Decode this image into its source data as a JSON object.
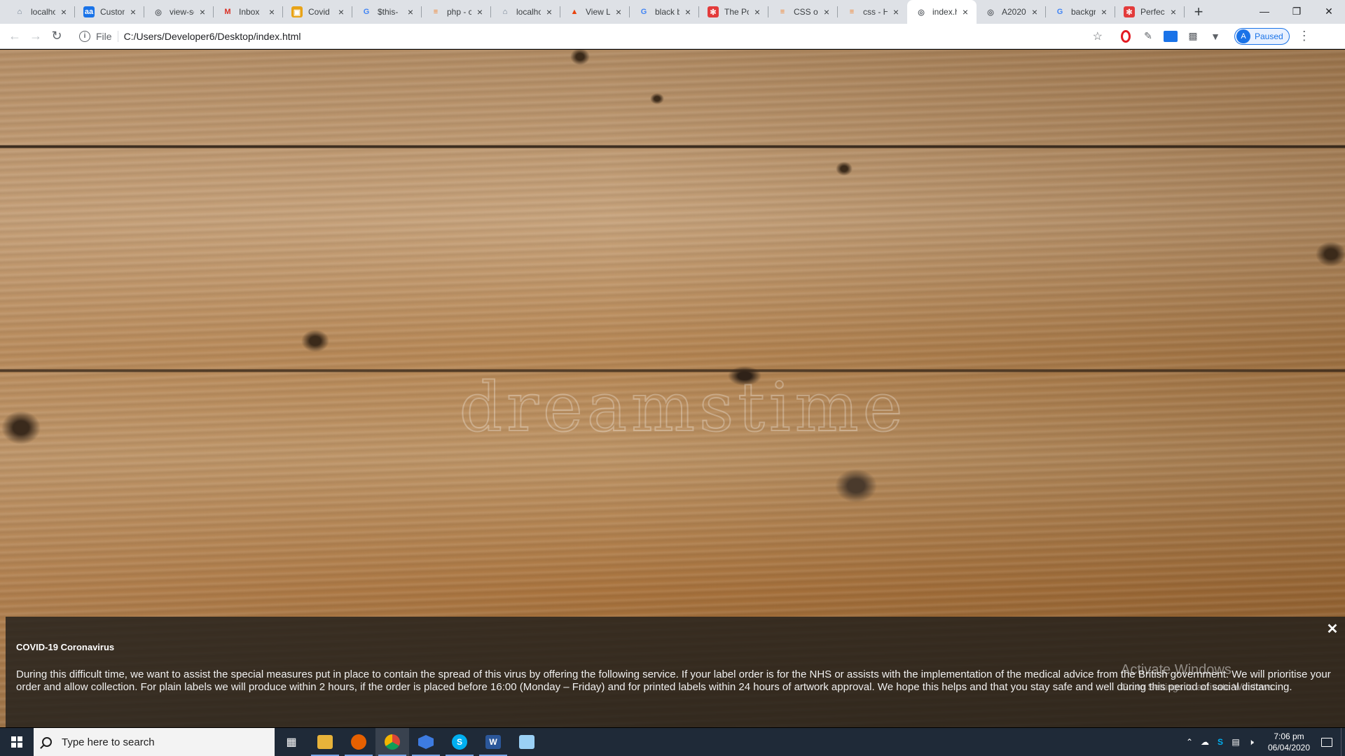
{
  "tabs": [
    {
      "label": "localhost",
      "icon": "localhost-icon",
      "active": false
    },
    {
      "label": "Customer",
      "icon": "aa-icon",
      "active": false
    },
    {
      "label": "view-source",
      "icon": "globe-icon",
      "active": false
    },
    {
      "label": "Inbox",
      "icon": "gmail-icon",
      "active": false
    },
    {
      "label": "Covid",
      "icon": "covid-icon",
      "active": false
    },
    {
      "label": "$this-",
      "icon": "google-icon",
      "active": false
    },
    {
      "label": "php - c",
      "icon": "stackoverflow-icon",
      "active": false
    },
    {
      "label": "localhost",
      "icon": "localhost-icon",
      "active": false
    },
    {
      "label": "View L",
      "icon": "flame-icon",
      "active": false
    },
    {
      "label": "black b",
      "icon": "google-icon",
      "active": false
    },
    {
      "label": "The Po",
      "icon": "pinwheel-icon",
      "active": false
    },
    {
      "label": "CSS op",
      "icon": "stackoverflow-icon",
      "active": false
    },
    {
      "label": "css - H",
      "icon": "stackoverflow-icon",
      "active": false
    },
    {
      "label": "index.h",
      "icon": "globe-icon",
      "active": true
    },
    {
      "label": "A2020",
      "icon": "globe-icon",
      "active": false
    },
    {
      "label": "backgr",
      "icon": "google-icon",
      "active": false
    },
    {
      "label": "Perfec",
      "icon": "pinwheel-icon",
      "active": false
    }
  ],
  "toolbar": {
    "scheme": "File",
    "url": "C:/Users/Developer6/Desktop/index.html",
    "profile_initial": "A",
    "profile_label": "Paused"
  },
  "page": {
    "watermark": "dreamstime"
  },
  "notice": {
    "title": "COVID-19 Coronavirus",
    "body": "During this difficult time, we want to assist the special measures put in place to contain the spread of this virus by offering the following service. If your label order is for the NHS or assists with the implementation of the medical advice from the British government. We will prioritise your order and allow collection. For plain labels we will produce within 2 hours, if the order is placed before 16:00 (Monday – Friday) and for printed labels within 24 hours of artwork approval. We hope this helps and that you stay safe and well during this period of social distancing.",
    "close": "✕"
  },
  "activation": {
    "line1": "Activate Windows",
    "line2": "Go to Settings to activate Windows."
  },
  "taskbar": {
    "search_placeholder": "Type here to search",
    "time": "7:06 pm",
    "date": "06/04/2020"
  },
  "colors": {
    "tabstrip": "#dee1e6",
    "accent": "#1a73e8",
    "taskbar": "#1f2a38",
    "notice_bg": "rgba(33,30,27,0.82)"
  }
}
